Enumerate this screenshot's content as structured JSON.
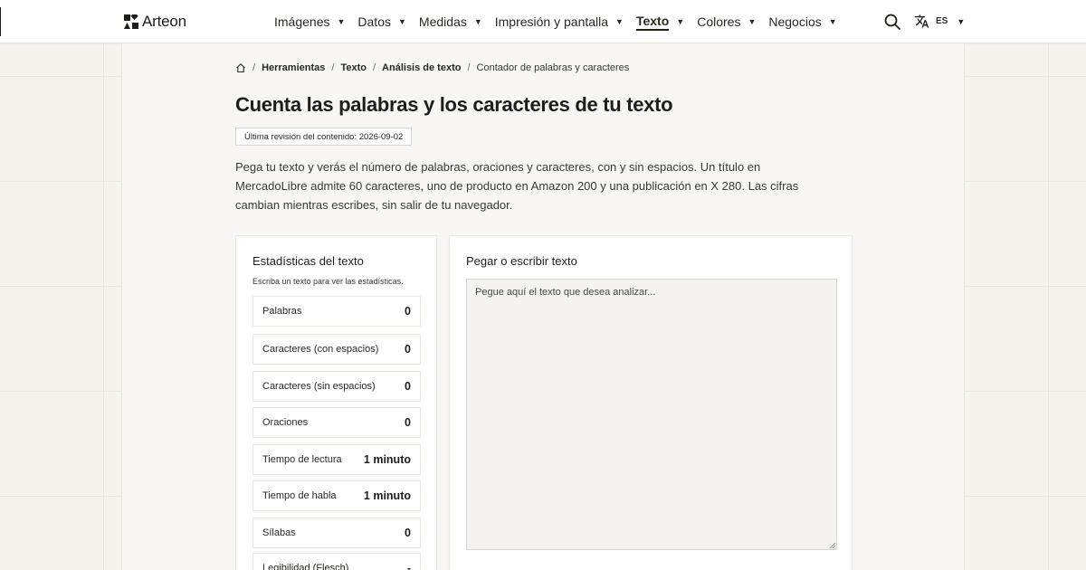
{
  "header": {
    "logo_text": "Arteon",
    "nav": [
      {
        "label": "Imágenes",
        "active": false
      },
      {
        "label": "Datos",
        "active": false
      },
      {
        "label": "Medidas",
        "active": false
      },
      {
        "label": "Impresión y pantalla",
        "active": false
      },
      {
        "label": "Texto",
        "active": true
      },
      {
        "label": "Colores",
        "active": false
      },
      {
        "label": "Negocios",
        "active": false
      }
    ],
    "caret": "▼",
    "search_icon": "search-icon",
    "language": {
      "icon": "translate-icon",
      "code": "ES"
    }
  },
  "breadcrumb": {
    "home_icon": "home-icon",
    "separator": "/",
    "items": [
      "Herramientas",
      "Texto",
      "Análisis de texto"
    ],
    "current": "Contador de palabras y caracteres"
  },
  "page": {
    "title": "Cuenta las palabras y los caracteres de tu texto",
    "revision": "Última revisión del contenido: 2026-09-02",
    "intro": "Pega tu texto y verás el número de palabras, oraciones y caracteres, con y sin espacios. Un título en MercadoLibre admite 60 caracteres, uno de producto en Amazon 200 y una publicación en X 280. Las cifras cambian mientras escribes, sin salir de tu navegador."
  },
  "stats": {
    "title": "Estadísticas del texto",
    "hint": "Escriba un texto para ver las estadísticas.",
    "rows": [
      {
        "label": "Palabras",
        "value": "0"
      },
      {
        "label": "Caracteres (con espacios)",
        "value": "0"
      },
      {
        "label": "Caracteres (sin espacios)",
        "value": "0"
      },
      {
        "label": "Oraciones",
        "value": "0"
      },
      {
        "label": "Tiempo de lectura",
        "value": "1 minuto"
      },
      {
        "label": "Tiempo de habla",
        "value": "1 minuto"
      },
      {
        "label": "Sílabas",
        "value": "0"
      },
      {
        "label": "Legibilidad (Flesch)",
        "value": "-"
      }
    ]
  },
  "editor": {
    "title": "Pegar o escribir texto",
    "value": "",
    "placeholder": "Pegue aquí el texto que desea analizar..."
  },
  "colors": {
    "accent": "#1f1d1a",
    "background": "#f6f3ef",
    "card": "#ffffff"
  }
}
